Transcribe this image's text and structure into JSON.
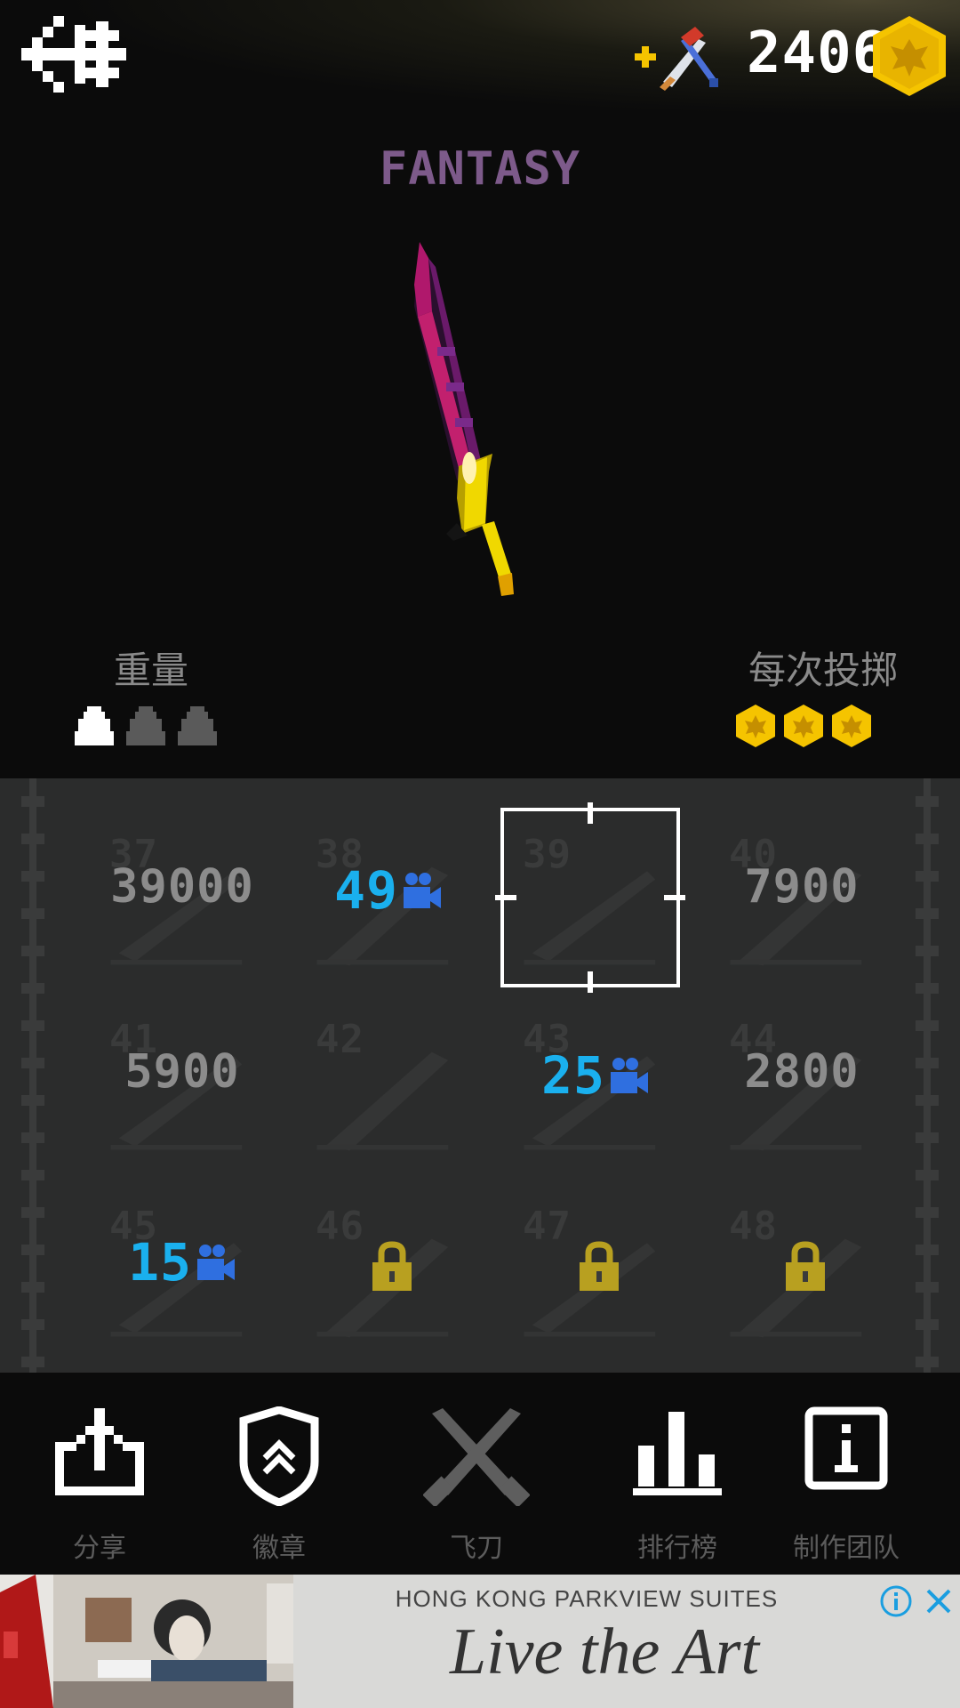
{
  "header": {
    "coins": "2406"
  },
  "weapon": {
    "title": "FANTASY",
    "weight_label": "重量",
    "throw_label": "每次投掷",
    "weight_level": 1,
    "weight_max": 3,
    "reward_per_throw": 3
  },
  "grid": {
    "cells": [
      {
        "num": "37",
        "price": "39000",
        "kind": "price"
      },
      {
        "num": "38",
        "price": "49",
        "kind": "video"
      },
      {
        "num": "39",
        "price": "",
        "kind": "selected"
      },
      {
        "num": "40",
        "price": "7900",
        "kind": "price"
      },
      {
        "num": "41",
        "price": "5900",
        "kind": "price"
      },
      {
        "num": "42",
        "price": "",
        "kind": "owned"
      },
      {
        "num": "43",
        "price": "25",
        "kind": "video"
      },
      {
        "num": "44",
        "price": "2800",
        "kind": "price"
      },
      {
        "num": "45",
        "price": "15",
        "kind": "video"
      },
      {
        "num": "46",
        "price": "",
        "kind": "locked"
      },
      {
        "num": "47",
        "price": "",
        "kind": "locked"
      },
      {
        "num": "48",
        "price": "",
        "kind": "locked"
      }
    ]
  },
  "nav": {
    "share": "分享",
    "badges": "徽章",
    "knives": "飞刀",
    "leaderboard": "排行榜",
    "credits": "制作团队"
  },
  "ad": {
    "hotel": "HONG KONG PARKVIEW SUITES",
    "tagline": "Live the Art"
  },
  "colors": {
    "coin": "#f5c400",
    "video_price": "#1ab0ee",
    "camera": "#2f6fe0",
    "lock": "#b8a020",
    "panel": "#2b2c2c"
  }
}
